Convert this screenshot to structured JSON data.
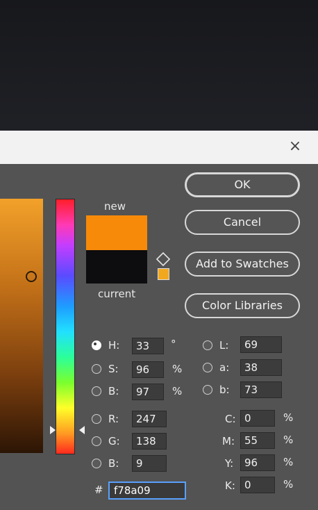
{
  "dialog": {
    "close_glyph": "×",
    "new_label": "new",
    "current_label": "current",
    "new_color": "#f78a09",
    "current_color": "#0d0c0e"
  },
  "buttons": {
    "ok": "OK",
    "cancel": "Cancel",
    "add_to_swatches": "Add to Swatches",
    "color_libraries": "Color Libraries"
  },
  "hsb": {
    "h_label": "H:",
    "h_value": "33",
    "h_unit": "°",
    "s_label": "S:",
    "s_value": "96",
    "s_unit": "%",
    "b_label": "B:",
    "b_value": "97",
    "b_unit": "%"
  },
  "lab": {
    "l_label": "L:",
    "l_value": "69",
    "a_label": "a:",
    "a_value": "38",
    "b_label": "b:",
    "b_value": "73"
  },
  "rgb": {
    "r_label": "R:",
    "r_value": "247",
    "g_label": "G:",
    "g_value": "138",
    "b_label": "B:",
    "b_value": "9"
  },
  "cmyk": {
    "c_label": "C:",
    "c_value": "0",
    "c_unit": "%",
    "m_label": "M:",
    "m_value": "55",
    "m_unit": "%",
    "y_label": "Y:",
    "y_value": "96",
    "y_unit": "%",
    "k_label": "K:",
    "k_value": "0",
    "k_unit": "%"
  },
  "hex": {
    "hash": "#",
    "value": "f78a09"
  },
  "icons": {
    "close": "close-icon",
    "gamut": "cube-icon",
    "websafe": "websafe-swatch-icon"
  }
}
